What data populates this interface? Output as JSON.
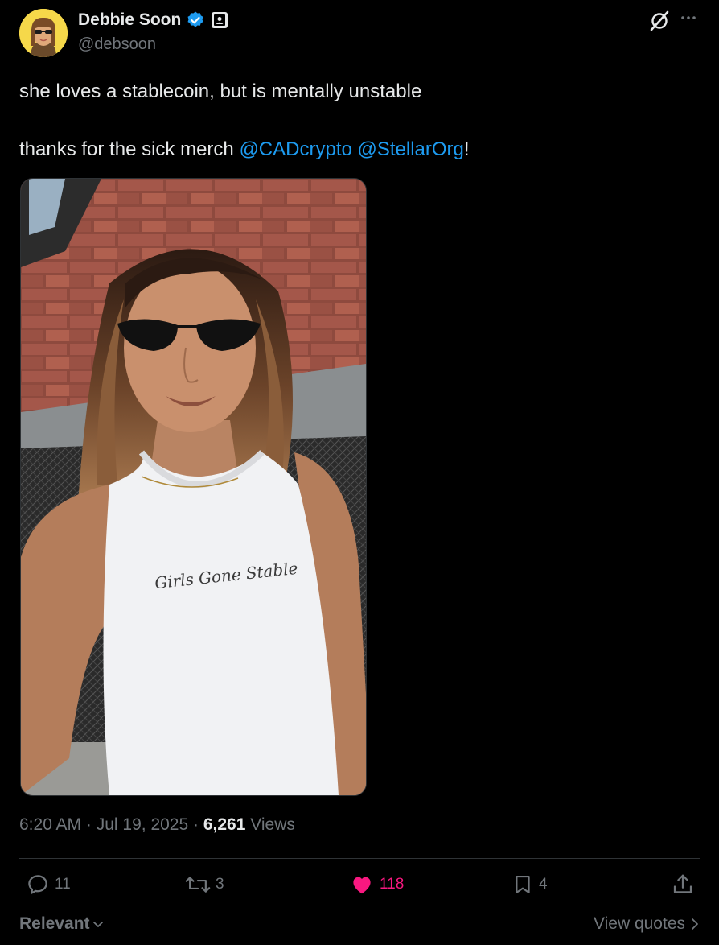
{
  "author": {
    "name": "Debbie Soon",
    "handle": "@debsoon"
  },
  "tweet": {
    "line1": "she loves a stablecoin, but is mentally unstable",
    "line2_prefix": "thanks for the sick merch ",
    "mention1": "@CADcrypto",
    "mention2": "@StellarOrg",
    "line2_suffix": "!"
  },
  "photo": {
    "shirt_text": "Girls Gone Stable"
  },
  "meta": {
    "time": "6:20 AM",
    "sep1": " · ",
    "date": "Jul 19, 2025",
    "sep2": " · ",
    "views_count": "6,261",
    "views_label": " Views"
  },
  "actions": {
    "replies": "11",
    "reposts": "3",
    "likes": "118",
    "bookmarks": "4"
  },
  "footer": {
    "sort_label": "Relevant",
    "view_quotes": "View quotes"
  },
  "colors": {
    "background": "#000000",
    "text": "#e7e9ea",
    "muted": "#71767b",
    "link": "#1d9bf0",
    "like": "#f91880",
    "verified": "#1d9bf0"
  }
}
